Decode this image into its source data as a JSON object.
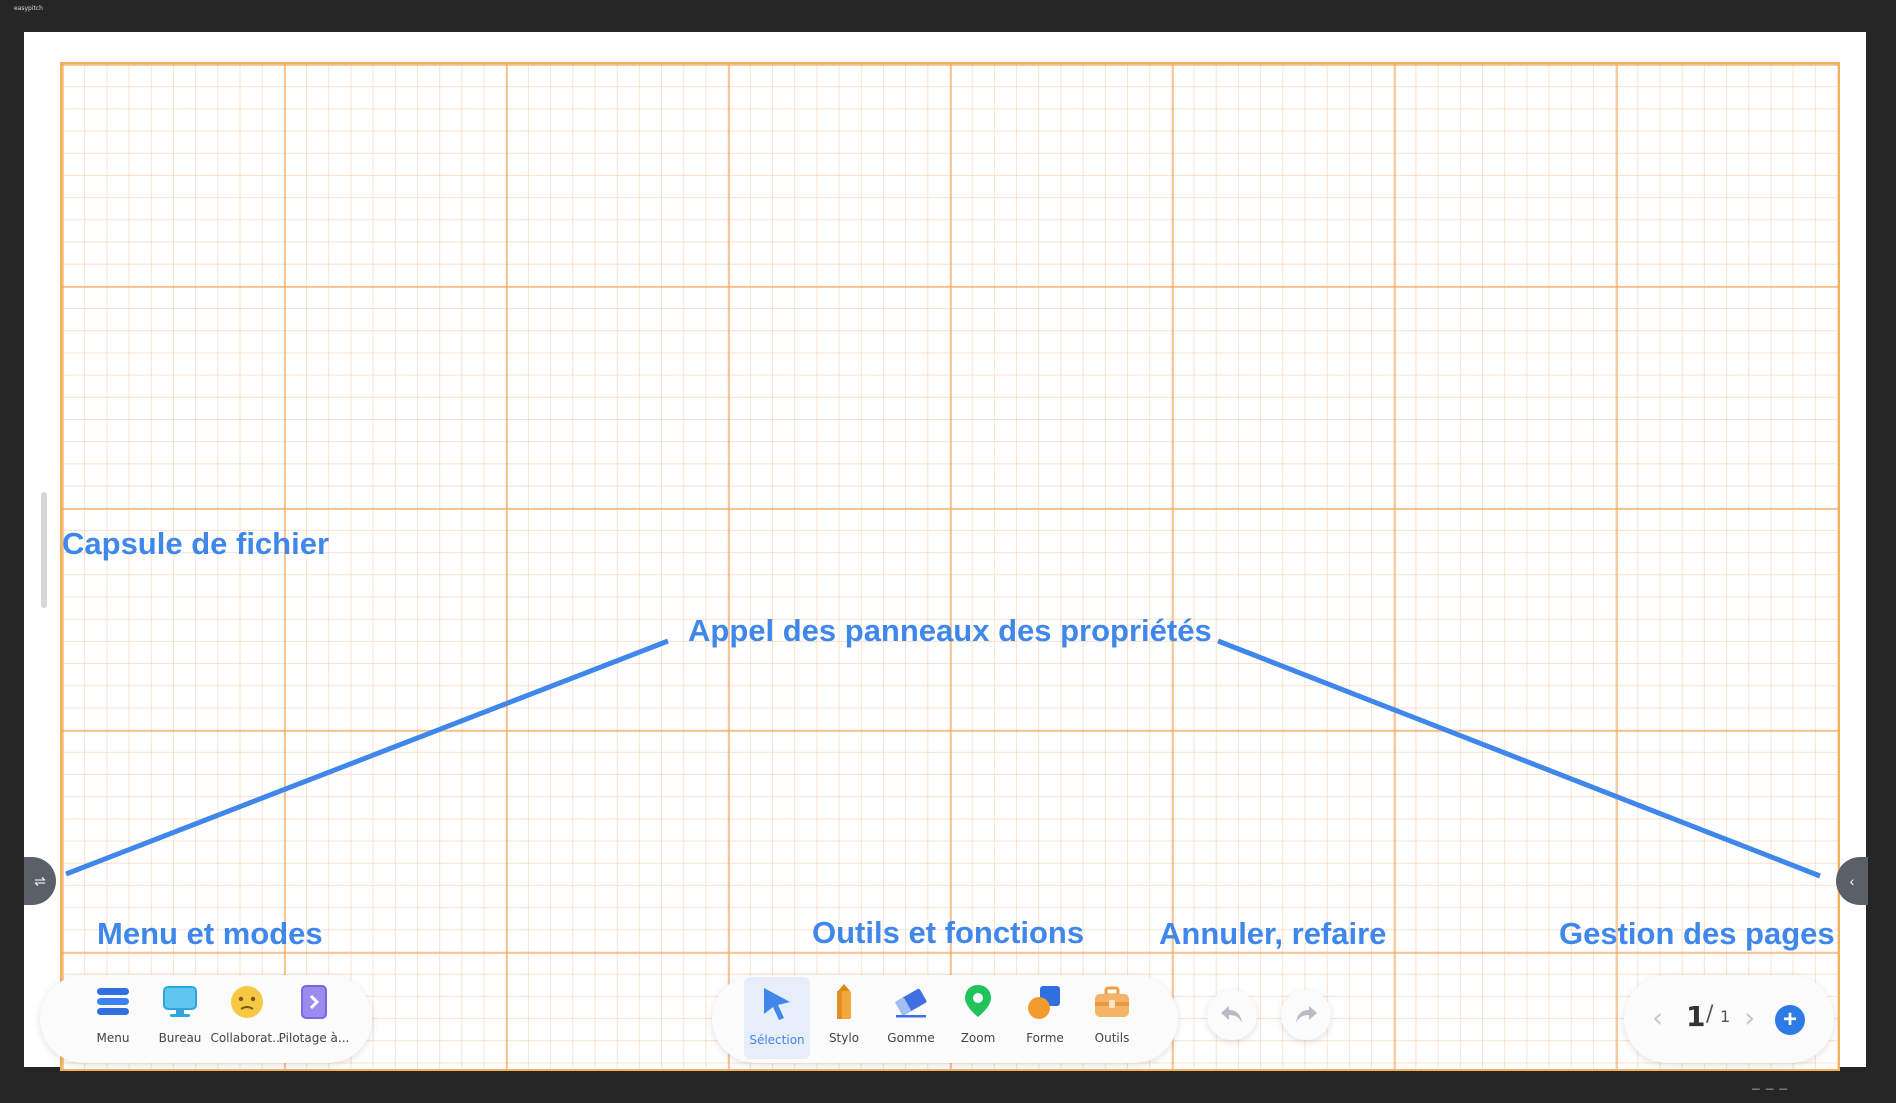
{
  "colors": {
    "accent": "#3f87ea",
    "grid": "#f3a050",
    "bezel": "#262626",
    "active_bg": "#e7eefa"
  },
  "app": {
    "logo_label": "easypitch"
  },
  "annotations": {
    "file_capsule": "Capsule de fichier",
    "properties_panels": "Appel des panneaux des propriétés",
    "menu_modes": "Menu et modes",
    "tools_functions": "Outils et fonctions",
    "undo_redo": "Annuler, refaire",
    "page_management": "Gestion des pages"
  },
  "toolbar_left": {
    "items": [
      {
        "label": "Menu",
        "icon": "menu-icon"
      },
      {
        "label": "Bureau",
        "icon": "desktop-icon"
      },
      {
        "label": "Collaborat...",
        "icon": "collaboration-icon"
      },
      {
        "label": "Pilotage à...",
        "icon": "remote-control-icon"
      }
    ]
  },
  "toolbar_center": {
    "active": "Sélection",
    "items": [
      {
        "label": "Sélection",
        "icon": "cursor-icon"
      },
      {
        "label": "Stylo",
        "icon": "pen-icon"
      },
      {
        "label": "Gomme",
        "icon": "eraser-icon"
      },
      {
        "label": "Zoom",
        "icon": "location-pin-icon"
      },
      {
        "label": "Forme",
        "icon": "shape-icon"
      },
      {
        "label": "Outils",
        "icon": "toolbox-icon"
      }
    ]
  },
  "history": {
    "undo_icon": "undo-icon",
    "redo_icon": "redo-icon"
  },
  "pager": {
    "current": "1",
    "separator": "/",
    "total": "1",
    "add_icon": "plus-icon"
  },
  "side_tabs": {
    "left_icon": "swap-icon",
    "right_icon": "chevron-left-icon"
  }
}
